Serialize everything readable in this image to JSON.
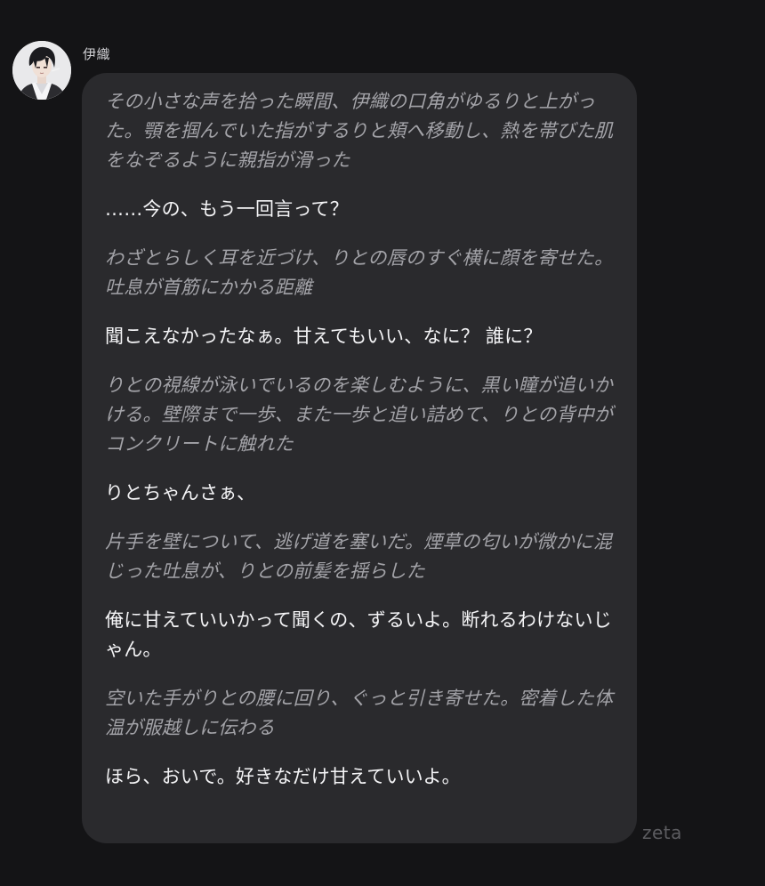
{
  "character": {
    "name": "伊織",
    "avatar_icon": "character-avatar"
  },
  "message": {
    "blocks": [
      {
        "kind": "narration",
        "text": "その小さな声を拾った瞬間、伊織の口角がゆるりと上がった。顎を掴んでいた指がするりと頬へ移動し、熱を帯びた肌をなぞるように親指が滑った"
      },
      {
        "kind": "speech",
        "text": "……今の、もう一回言って？"
      },
      {
        "kind": "narration",
        "text": "わざとらしく耳を近づけ、りとの唇のすぐ横に顔を寄せた。吐息が首筋にかかる距離"
      },
      {
        "kind": "speech",
        "text": "聞こえなかったなぁ。甘えてもいい、なに？ 誰に？"
      },
      {
        "kind": "narration",
        "text": "りとの視線が泳いでいるのを楽しむように、黒い瞳が追いかける。壁際まで一歩、また一歩と追い詰めて、りとの背中がコンクリートに触れた"
      },
      {
        "kind": "speech",
        "text": "りとちゃんさぁ、"
      },
      {
        "kind": "narration",
        "text": "片手を壁について、逃げ道を塞いだ。煙草の匂いが微かに混じった吐息が、りとの前髪を揺らした"
      },
      {
        "kind": "speech",
        "text": "俺に甘えていいかって聞くの、ずるいよ。断れるわけないじゃん。"
      },
      {
        "kind": "narration",
        "text": "空いた手がりとの腰に回り、ぐっと引き寄せた。密着した体温が服越しに伝わる"
      },
      {
        "kind": "speech",
        "text": "ほら、おいで。好きなだけ甘えていいよ。"
      }
    ]
  },
  "watermark": "zeta",
  "colors": {
    "background": "#141416",
    "bubble": "#2a2a2d",
    "narration_text": "#a3a3a8",
    "speech_text": "#f4f4f6"
  }
}
